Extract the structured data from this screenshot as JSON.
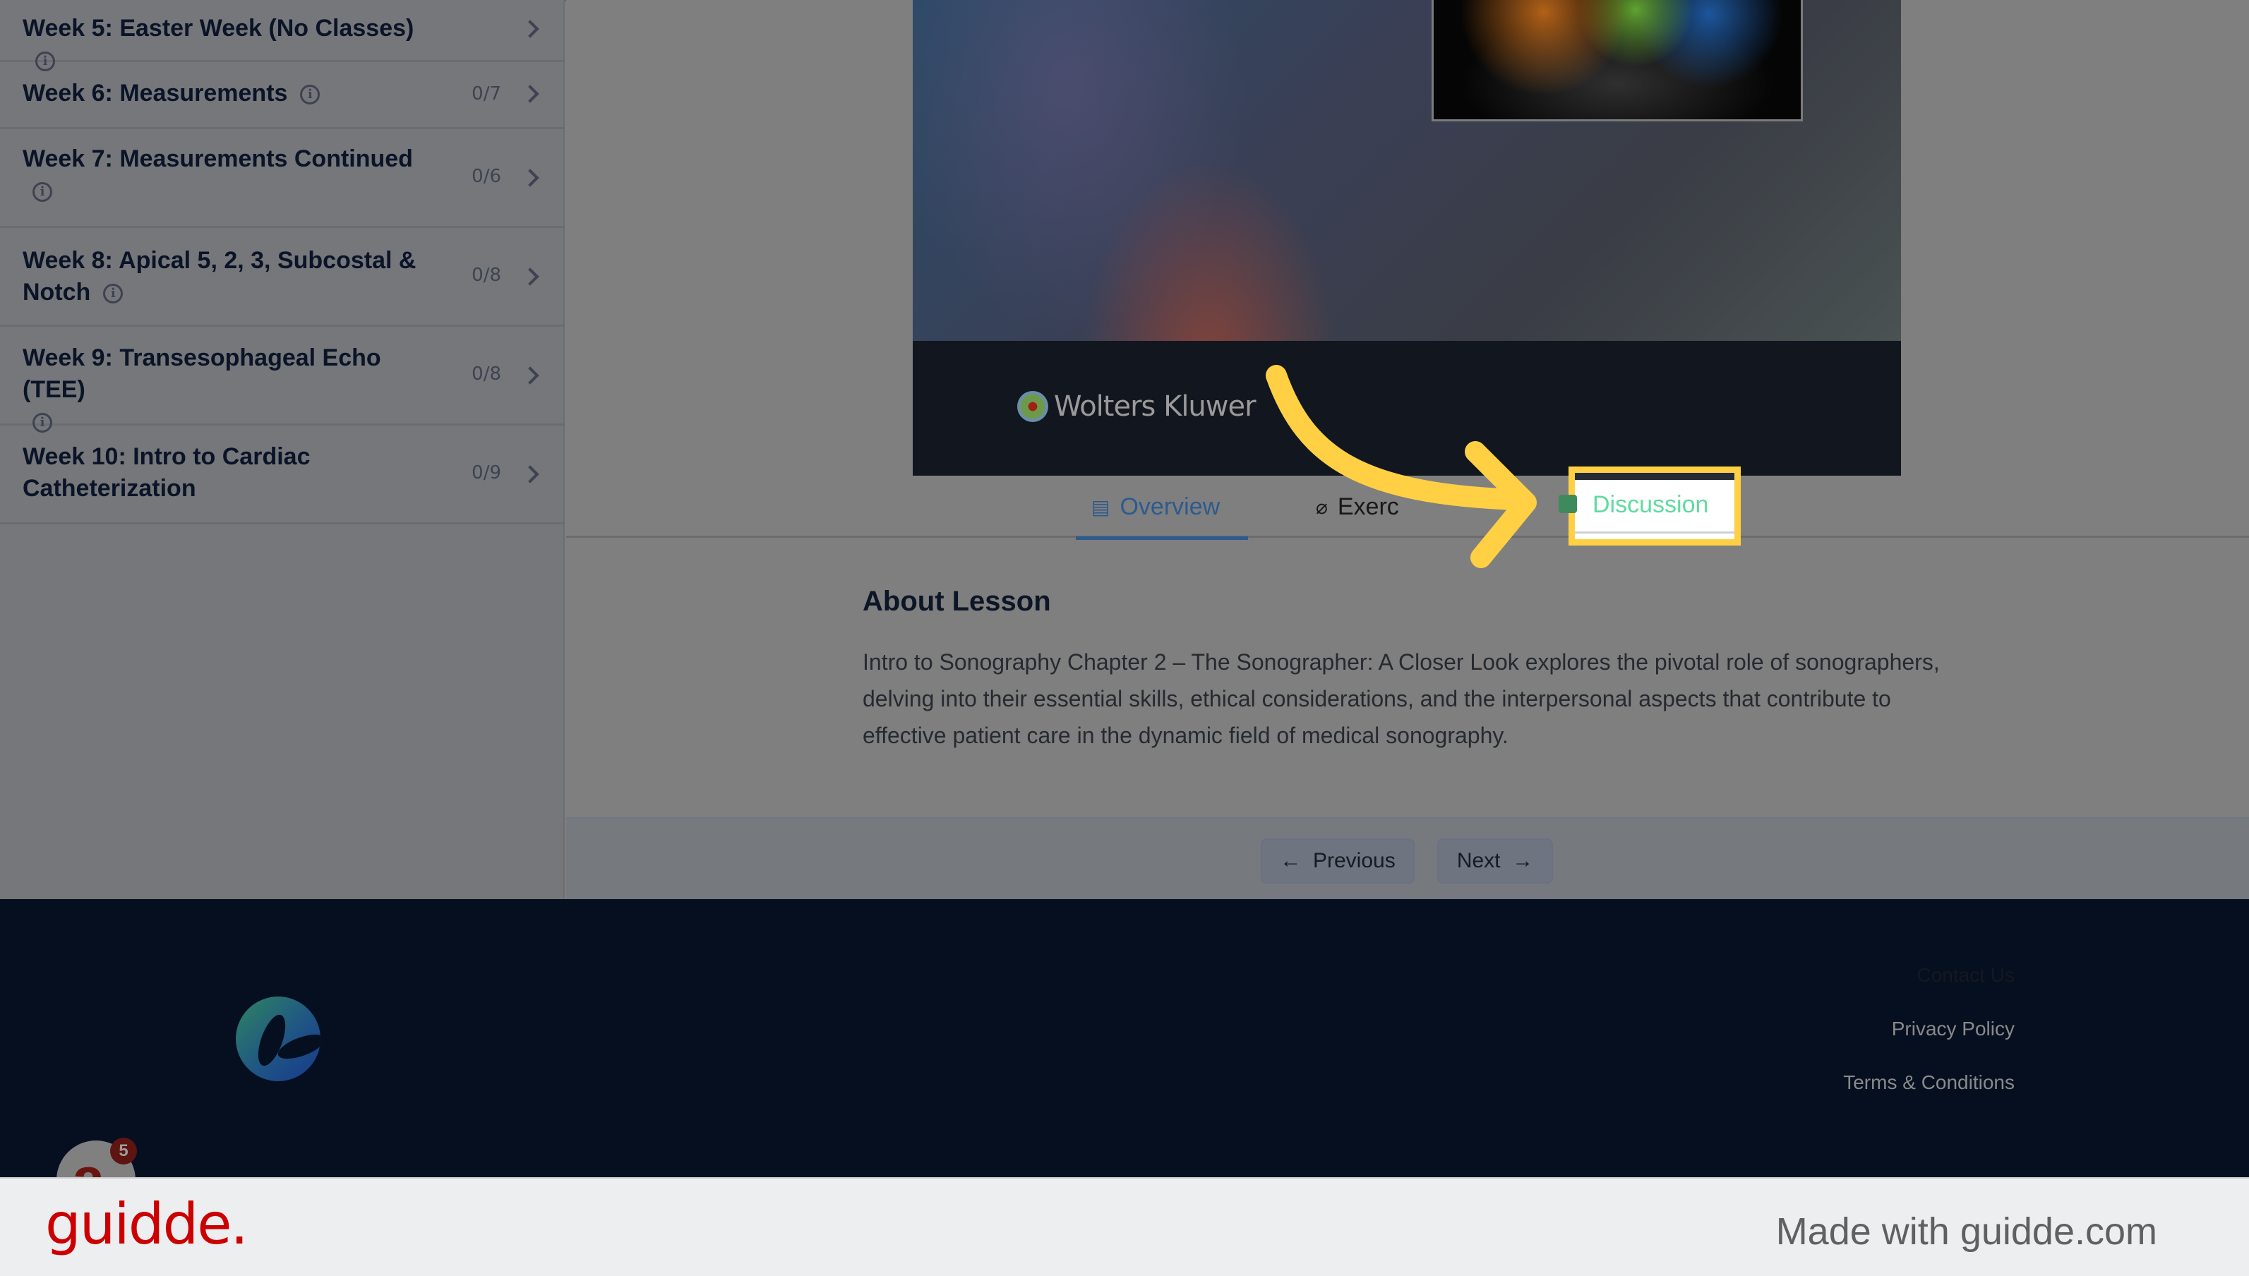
{
  "sidebar": {
    "topics": [
      {
        "title": "Week 5: Easter Week (No Classes)",
        "count": "",
        "info": "i"
      },
      {
        "title": "Week 6: Measurements",
        "count": "0/7",
        "info": "i"
      },
      {
        "title": "Week 7: Measurements Continued",
        "count": "0/6",
        "info": "i"
      },
      {
        "title": "Week 8: Apical 5, 2, 3, Subcostal & Notch",
        "count": "0/8",
        "info": "i"
      },
      {
        "title": "Week 9: Transesophageal Echo (TEE)",
        "count": "0/8",
        "info": "i"
      },
      {
        "title": "Week 10: Intro to Cardiac Catheterization",
        "count": "0/9",
        "info": ""
      }
    ]
  },
  "video": {
    "brand": "Wolters Kluwer"
  },
  "tabs": [
    {
      "label": "Overview",
      "icon": "document-icon",
      "glyph": "▤",
      "active": true
    },
    {
      "label": "Exercise Files",
      "icon": "paperclip-icon",
      "glyph": "🖇"
    },
    {
      "label": "Discussion",
      "icon": "chat-icon",
      "glyph": "▮",
      "highlighted": true
    }
  ],
  "tab_visible_text": {
    "overview": "Overview",
    "exercise": "Exerc",
    "discussion": "Discussion"
  },
  "about": {
    "title": "About Lesson",
    "text": "Intro to Sonography Chapter 2 – The Sonographer: A Closer Look explores the pivotal role of sonographers, delving into their essential skills, ethical considerations, and the interpersonal aspects that contribute to effective patient care in the dynamic field of medical sonography."
  },
  "nav": {
    "previous": "Previous",
    "previous_glyph": "←",
    "next": "Next",
    "next_glyph": "→"
  },
  "footer": {
    "contact": "Contact Us",
    "privacy": "Privacy Policy",
    "terms": "Terms & Conditions"
  },
  "chat": {
    "glyph": "a",
    "badge": "5"
  },
  "guidde": {
    "logo": "guidde.",
    "made_with": "Made with guidde.com"
  },
  "colors": {
    "highlight": "#ffd043",
    "active_tab": "#2d5a8f",
    "discussion": "#5fdba0",
    "footer_bg": "#050f20",
    "guidde_red": "#cc0000"
  }
}
